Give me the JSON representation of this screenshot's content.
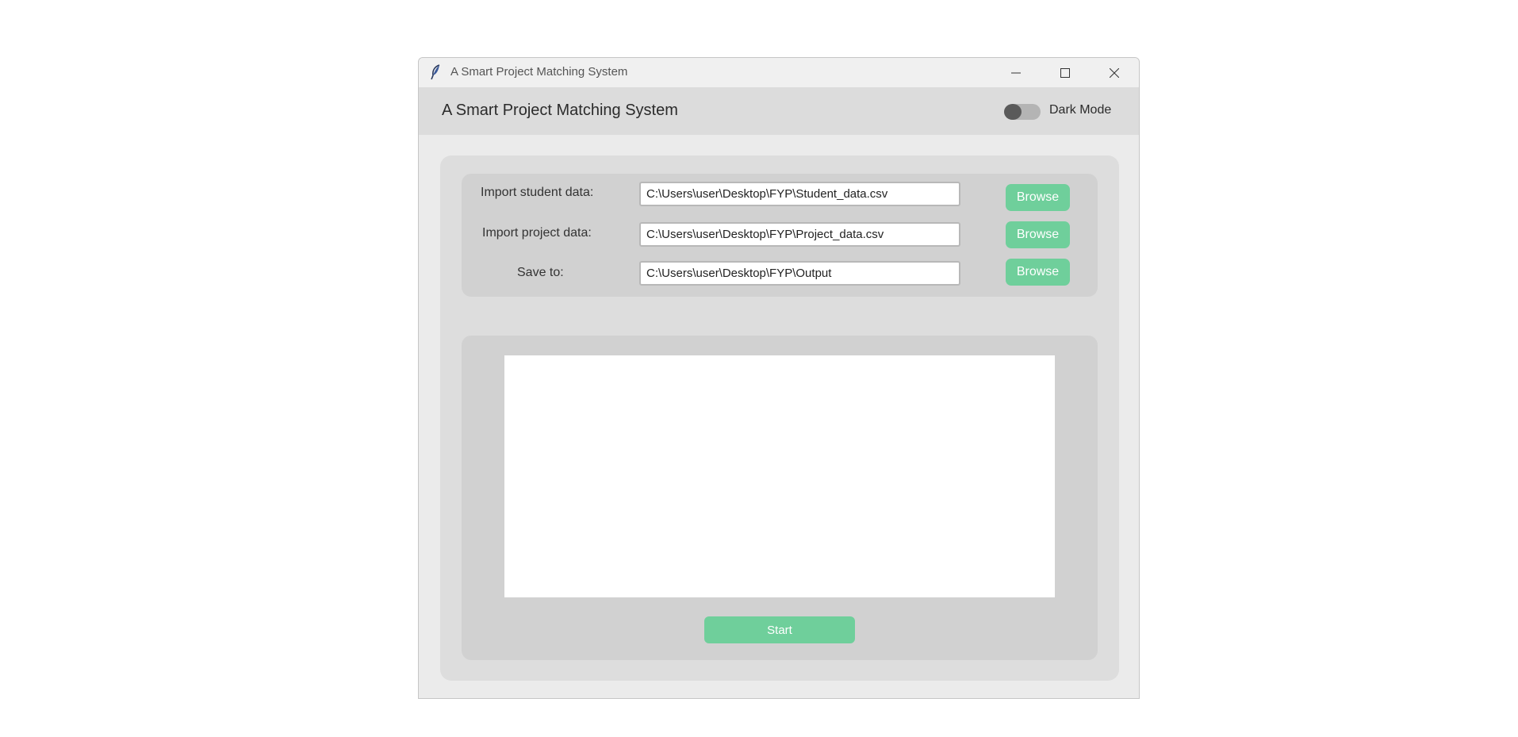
{
  "window": {
    "title": "A Smart Project Matching System",
    "icon": "feather-icon",
    "controls": [
      "minimize-icon",
      "maximize-icon",
      "close-icon"
    ]
  },
  "header": {
    "title": "A Smart Project Matching System",
    "dark_mode": {
      "label": "Dark Mode",
      "enabled": false
    }
  },
  "inputs": {
    "student": {
      "label": "Import student data:",
      "value": "C:\\Users\\user\\Desktop\\FYP\\Student_data.csv",
      "button": "Browse"
    },
    "project": {
      "label": "Import project data:",
      "value": "C:\\Users\\user\\Desktop\\FYP\\Project_data.csv",
      "button": "Browse"
    },
    "output": {
      "label": "Save to:",
      "value": "C:\\Users\\user\\Desktop\\FYP\\Output",
      "button": "Browse"
    }
  },
  "log": {
    "value": ""
  },
  "actions": {
    "start_label": "Start"
  },
  "colors": {
    "accent": "#6fcf9b",
    "panel": "#d1d1d1",
    "outer_panel": "#dddddd",
    "header": "#dcdcdc",
    "window_bg": "#ebebeb"
  }
}
